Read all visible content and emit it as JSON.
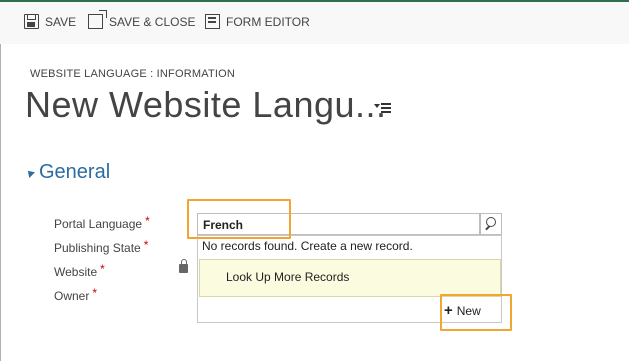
{
  "toolbar": {
    "save_label": "SAVE",
    "save_close_label": "SAVE & CLOSE",
    "form_editor_label": "FORM EDITOR"
  },
  "header": {
    "breadcrumb": "WEBSITE LANGUAGE : INFORMATION",
    "title": "New Website Langu..."
  },
  "section": {
    "title": "General"
  },
  "fields": [
    {
      "label": "Portal Language",
      "required_mark": "*"
    },
    {
      "label": "Publishing State",
      "required_mark": "*"
    },
    {
      "label": "Website",
      "required_mark": "*"
    },
    {
      "label": "Owner",
      "required_mark": "*"
    }
  ],
  "lookup": {
    "value": "French",
    "no_records_text": "No records found. Create a new record.",
    "look_up_more": "Look Up More Records",
    "new_label": "New"
  },
  "colors": {
    "highlight": "#f0a630",
    "section_accent": "#2d6ca2",
    "required": "#cc0000",
    "look_up_more_bg": "#fbfbe0"
  }
}
